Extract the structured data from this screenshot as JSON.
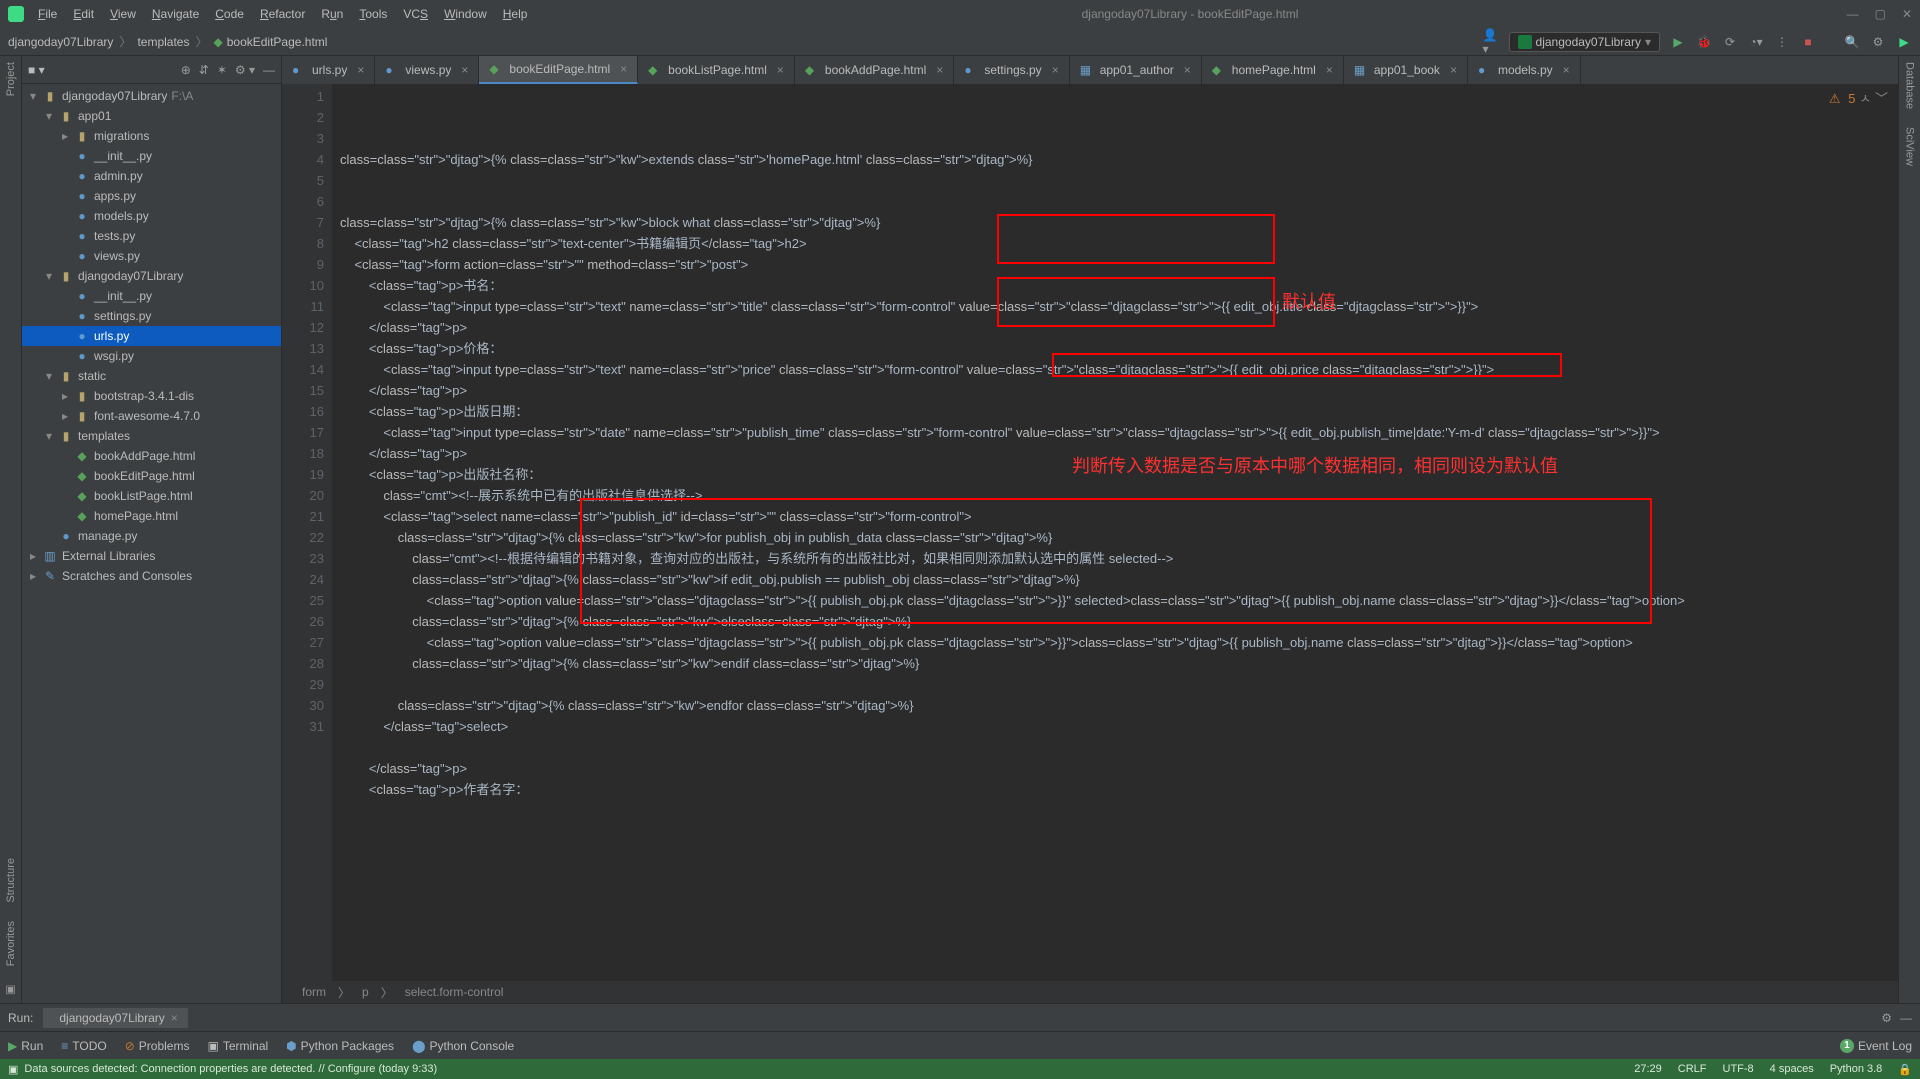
{
  "window": {
    "title": "djangoday07Library - bookEditPage.html",
    "menus": [
      "File",
      "Edit",
      "View",
      "Navigate",
      "Code",
      "Refactor",
      "Run",
      "Tools",
      "VCS",
      "Window",
      "Help"
    ]
  },
  "breadcrumbs": [
    "djangoday07Library",
    "templates",
    "bookEditPage.html"
  ],
  "run_config": "djangoday07Library",
  "project_toolbar_title": "",
  "tree": [
    {
      "depth": 0,
      "type": "folder",
      "chev": "▾",
      "label": "djangoday07Library",
      "suffix": "F:\\A"
    },
    {
      "depth": 1,
      "type": "folder",
      "chev": "▾",
      "label": "app01"
    },
    {
      "depth": 2,
      "type": "folder",
      "chev": "▸",
      "label": "migrations"
    },
    {
      "depth": 2,
      "type": "py",
      "label": "__init__.py"
    },
    {
      "depth": 2,
      "type": "py",
      "label": "admin.py"
    },
    {
      "depth": 2,
      "type": "py",
      "label": "apps.py"
    },
    {
      "depth": 2,
      "type": "py",
      "label": "models.py"
    },
    {
      "depth": 2,
      "type": "py",
      "label": "tests.py"
    },
    {
      "depth": 2,
      "type": "py",
      "label": "views.py"
    },
    {
      "depth": 1,
      "type": "folder",
      "chev": "▾",
      "label": "djangoday07Library"
    },
    {
      "depth": 2,
      "type": "py",
      "label": "__init__.py"
    },
    {
      "depth": 2,
      "type": "py",
      "label": "settings.py"
    },
    {
      "depth": 2,
      "type": "py",
      "label": "urls.py",
      "selected": true
    },
    {
      "depth": 2,
      "type": "py",
      "label": "wsgi.py"
    },
    {
      "depth": 1,
      "type": "folder",
      "chev": "▾",
      "label": "static"
    },
    {
      "depth": 2,
      "type": "folder",
      "chev": "▸",
      "label": "bootstrap-3.4.1-dis"
    },
    {
      "depth": 2,
      "type": "folder",
      "chev": "▸",
      "label": "font-awesome-4.7.0"
    },
    {
      "depth": 1,
      "type": "folder",
      "chev": "▾",
      "label": "templates"
    },
    {
      "depth": 2,
      "type": "html",
      "label": "bookAddPage.html"
    },
    {
      "depth": 2,
      "type": "html",
      "label": "bookEditPage.html"
    },
    {
      "depth": 2,
      "type": "html",
      "label": "bookListPage.html"
    },
    {
      "depth": 2,
      "type": "html",
      "label": "homePage.html"
    },
    {
      "depth": 1,
      "type": "py",
      "label": "manage.py"
    },
    {
      "depth": 0,
      "type": "lib",
      "chev": "▸",
      "label": "External Libraries"
    },
    {
      "depth": 0,
      "type": "scratch",
      "chev": "▸",
      "label": "Scratches and Consoles"
    }
  ],
  "tabs": [
    {
      "icon": "py",
      "label": "urls.py"
    },
    {
      "icon": "py",
      "label": "views.py"
    },
    {
      "icon": "html",
      "label": "bookEditPage.html",
      "active": true
    },
    {
      "icon": "html",
      "label": "bookListPage.html"
    },
    {
      "icon": "html",
      "label": "bookAddPage.html"
    },
    {
      "icon": "py",
      "label": "settings.py"
    },
    {
      "icon": "db",
      "label": "app01_author"
    },
    {
      "icon": "html",
      "label": "homePage.html"
    },
    {
      "icon": "db",
      "label": "app01_book"
    },
    {
      "icon": "py",
      "label": "models.py"
    }
  ],
  "warnings": "5",
  "code_lines": [
    "{% extends 'homePage.html' %}",
    "",
    "",
    "{% block what %}",
    "    <h2 class=\"text-center\">书籍编辑页</h2>",
    "    <form action=\"\" method=\"post\">",
    "        <p>书名：",
    "            <input type=\"text\" name=\"title\" class=\"form-control\" value=\"{{ edit_obj.title }}\">",
    "        </p>",
    "        <p>价格：",
    "            <input type=\"text\" name=\"price\" class=\"form-control\" value=\"{{ edit_obj.price }}\">",
    "        </p>",
    "        <p>出版日期：",
    "            <input type=\"date\" name=\"publish_time\" class=\"form-control\" value=\"{{ edit_obj.publish_time|date:'Y-m-d' }}\">",
    "        </p>",
    "        <p>出版社名称：",
    "            <!--展示系统中已有的出版社信息供选择-->",
    "            <select name=\"publish_id\" id=\"\" class=\"form-control\">",
    "                {% for publish_obj in publish_data %}",
    "                    <!--根据待编辑的书籍对象，查询对应的出版社，与系统所有的出版社比对，如果相同则添加默认选中的属性 selected-->",
    "                    {% if edit_obj.publish == publish_obj %}",
    "                        <option value=\"{{ publish_obj.pk }}\" selected>{{ publish_obj.name }}</option>",
    "                    {% else%}",
    "                        <option value=\"{{ publish_obj.pk }}\">{{ publish_obj.name }}</option>",
    "                    {% endif %}",
    "",
    "                {% endfor %}",
    "            </select>",
    "",
    "        </p>",
    "        <p>作者名字："
  ],
  "annotations": {
    "label1": "默认值",
    "label2": "判断传入数据是否与原本中哪个数据相同，相同则设为默认值"
  },
  "code_crumb": [
    "form",
    "p",
    "select.form-control"
  ],
  "run_tab": "djangoday07Library",
  "run_label": "Run:",
  "bottom_tools": {
    "run": "Run",
    "todo": "TODO",
    "problems": "Problems",
    "terminal": "Terminal",
    "py_pkg": "Python Packages",
    "py_console": "Python Console",
    "event_log": "Event Log",
    "event_count": "1"
  },
  "status": {
    "msg": "Data sources detected: Connection properties are detected. // Configure (today 9:33)",
    "pos": "27:29",
    "le": "CRLF",
    "enc": "UTF-8",
    "indent": "4 spaces",
    "python": "Python 3.8"
  },
  "left_rail": [
    "Project",
    "Structure",
    "Favorites"
  ],
  "right_rail": [
    "Database",
    "SciView"
  ]
}
